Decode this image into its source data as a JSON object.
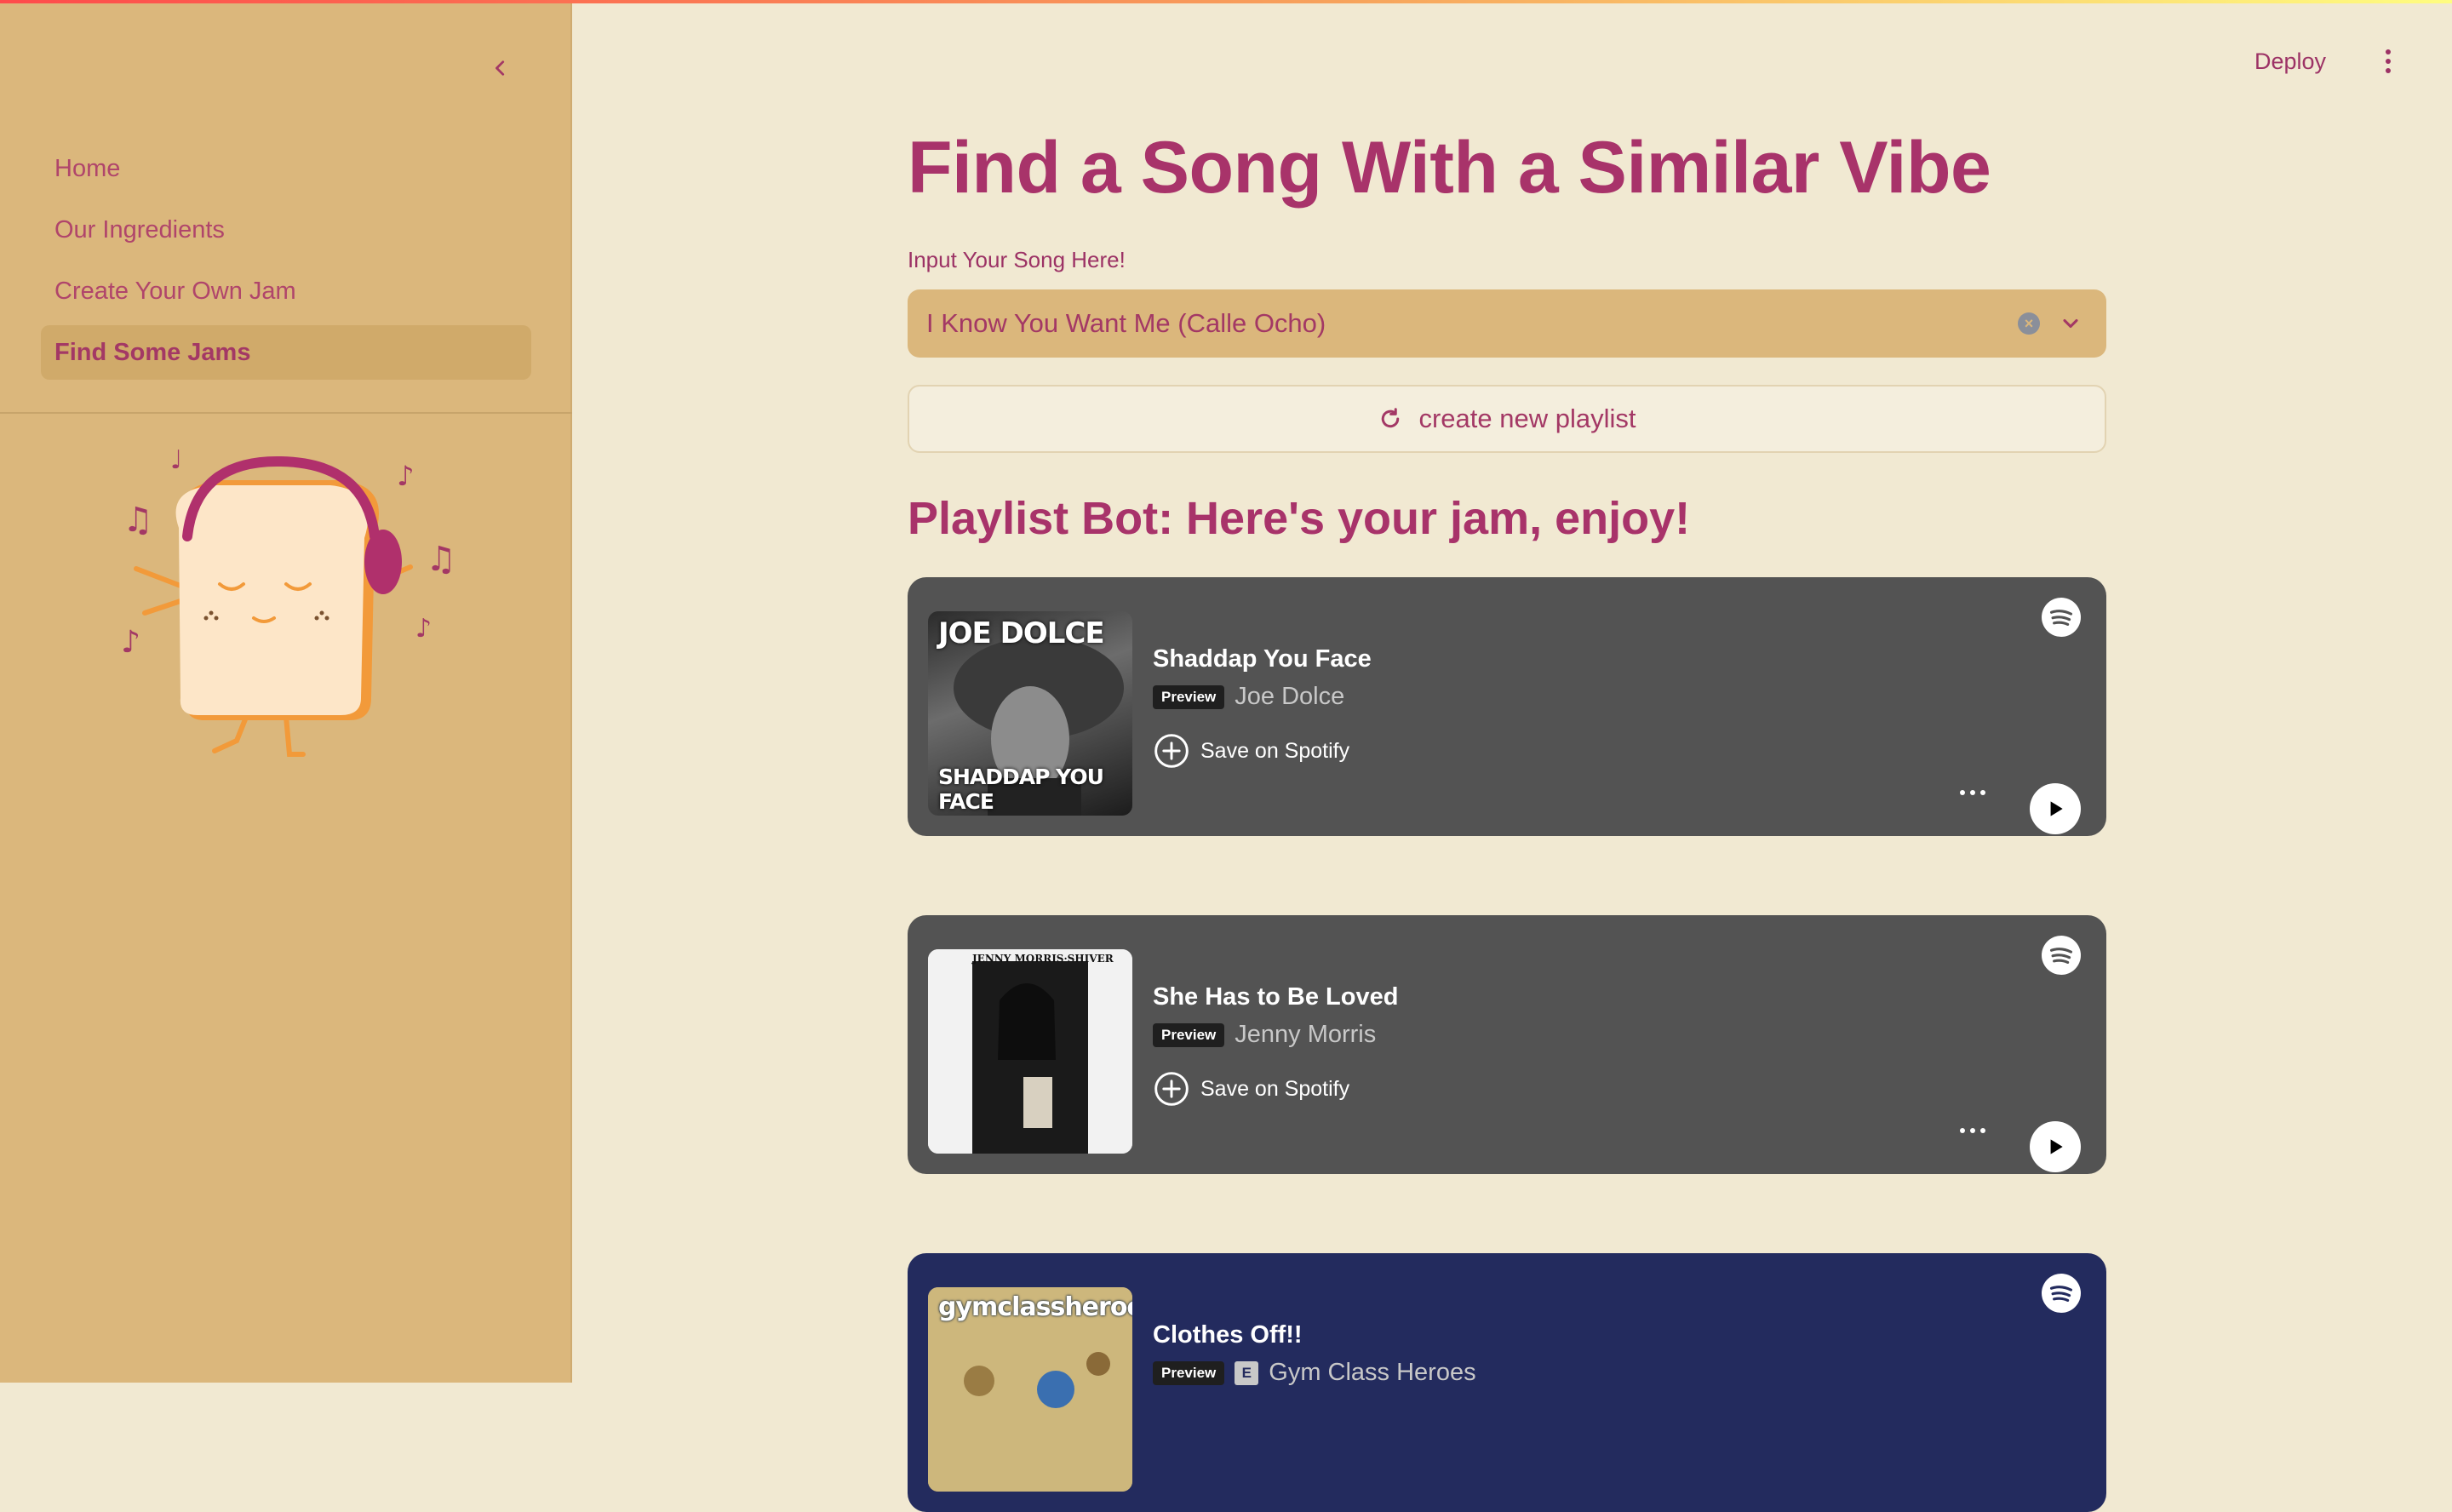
{
  "window": {
    "deploy_label": "Deploy"
  },
  "sidebar": {
    "items": [
      {
        "label": "Home"
      },
      {
        "label": "Our Ingredients"
      },
      {
        "label": "Create Your Own Jam"
      },
      {
        "label": "Find Some Jams",
        "active": true
      }
    ]
  },
  "main": {
    "title": "Find a Song With a Similar Vibe",
    "input_label": "Input Your Song Here!",
    "selected_song": "I Know You Want Me (Calle Ocho)",
    "playlist_button": "create new playlist",
    "bot_heading": "Playlist Bot: Here's your jam, enjoy!"
  },
  "tracks": [
    {
      "title": "Shaddap You Face",
      "artist": "Joe Dolce",
      "preview": "Preview",
      "save": "Save on Spotify",
      "cover_top": "JOE DOLCE",
      "cover_bottom": "SHADDAP YOU FACE"
    },
    {
      "title": "She Has to Be Loved",
      "artist": "Jenny Morris",
      "preview": "Preview",
      "save": "Save on Spotify",
      "cover_top": "JENNY MORRIS·SHIVER"
    },
    {
      "title": "Clothes Off!!",
      "artist": "Gym Class Heroes",
      "preview": "Preview",
      "explicit": "E",
      "cover_top": "gymclassheroes."
    }
  ],
  "colors": {
    "sidebar_bg": "#dbb77c",
    "page_bg": "#f1e9d2",
    "accent": "#a8336a",
    "card_gray": "#535353",
    "card_navy": "#232b5e"
  },
  "icons": [
    "chevron-left-icon",
    "kebab-menu-icon",
    "clear-icon",
    "chevron-down-icon",
    "refresh-icon",
    "spotify-icon",
    "add-circle-icon",
    "more-icon",
    "play-icon"
  ]
}
